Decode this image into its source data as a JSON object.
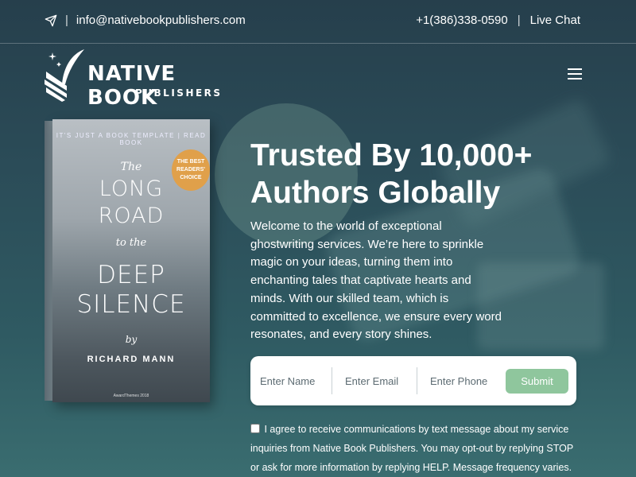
{
  "topbar": {
    "email": "info@nativebookpublishers.com",
    "separator": "|",
    "phone": "+1(386)338-0590",
    "live_chat": "Live Chat"
  },
  "logo": {
    "line1": "NATIVE BOOK",
    "line2": "PUBLISHERS"
  },
  "book": {
    "topline": "IT'S JUST A BOOK TEMPLATE   |   READ BOOK",
    "badge": "THE BEST READERS' CHOICE",
    "the": "The",
    "long": "LONG",
    "road": "ROAD",
    "to_the": "to the",
    "deep": "DEEP",
    "silence": "SILENCE",
    "by": "by",
    "author": "RICHARD MANN",
    "footer": "AwardThemes 2018"
  },
  "hero": {
    "headline_line1": "Trusted By 10,000+",
    "headline_line2": "Authors Globally",
    "intro": "Welcome to the world of exceptional ghostwriting services. We’re here to sprinkle magic on your ideas, turning them into enchanting tales that captivate hearts and minds. With our skilled team, which is committed to excellence, we ensure every word resonates, and every story shines."
  },
  "form": {
    "name_placeholder": "Enter Name",
    "email_placeholder": "Enter Email",
    "phone_placeholder": "Enter Phone",
    "submit_label": "Submit",
    "consent_text": "I agree to receive communications by text message about my service inquiries from Native Book Publishers. You may opt-out by replying STOP or ask for more information by replying HELP. Message frequency varies."
  },
  "colors": {
    "background": "#2b4c58",
    "submit": "#8fc69d",
    "badge": "#e0a04a"
  },
  "icons": [
    "send-icon",
    "hamburger-menu-icon",
    "feather-logo-icon"
  ]
}
